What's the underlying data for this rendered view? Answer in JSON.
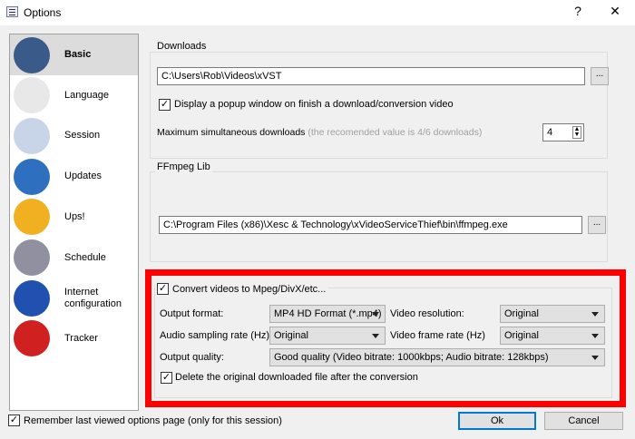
{
  "window": {
    "title": "Options",
    "help": "?",
    "close": "✕"
  },
  "sidebar": {
    "items": [
      {
        "label": "Basic",
        "icon": "hammer-icon",
        "color": "#3a5a8a"
      },
      {
        "label": "Language",
        "icon": "scroll-icon",
        "color": "#e8e8e8"
      },
      {
        "label": "Session",
        "icon": "notepad-pen-icon",
        "color": "#c8d4e8"
      },
      {
        "label": "Updates",
        "icon": "globe-update-icon",
        "color": "#2f6fc0"
      },
      {
        "label": "Ups!",
        "icon": "shield-icon",
        "color": "#f0b020"
      },
      {
        "label": "Schedule",
        "icon": "clock-icon",
        "color": "#9090a0"
      },
      {
        "label": "Internet configuration",
        "icon": "network-globe-icon",
        "color": "#2050b0"
      },
      {
        "label": "Tracker",
        "icon": "bug-magnifier-icon",
        "color": "#d02020"
      }
    ]
  },
  "downloads": {
    "title": "Downloads",
    "path": "C:\\Users\\Rob\\Videos\\xVST",
    "browse": "...",
    "popup_label": "Display a popup window on finish a download/conversion video",
    "popup_checked": true,
    "max_label": "Maximum simultaneous downloads",
    "max_hint": "(the recomended value is 4/6 downloads)",
    "max_value": "4"
  },
  "ffmpeg": {
    "title": "FFmpeg Lib",
    "path": "C:\\Program Files (x86)\\Xesc & Technology\\xVideoServiceThief\\bin\\ffmpeg.exe",
    "browse": "..."
  },
  "convert": {
    "label": "Convert videos to Mpeg/DivX/etc...",
    "checked": true,
    "output_format_label": "Output format:",
    "output_format": "MP4 HD Format (*.mp4)",
    "video_res_label": "Video resolution:",
    "video_res": "Original",
    "audio_rate_label": "Audio sampling rate (Hz):",
    "audio_rate": "Original",
    "frame_rate_label": "Video frame rate (Hz)",
    "frame_rate": "Original",
    "quality_label": "Output quality:",
    "quality": "Good quality (Video bitrate: 1000kbps; Audio bitrate: 128kbps)",
    "delete_label": "Delete the original downloaded file after the conversion",
    "delete_checked": true
  },
  "footer": {
    "remember_label": "Remember last viewed options page (only for this session)",
    "remember_checked": true,
    "ok": "Ok",
    "cancel": "Cancel"
  }
}
